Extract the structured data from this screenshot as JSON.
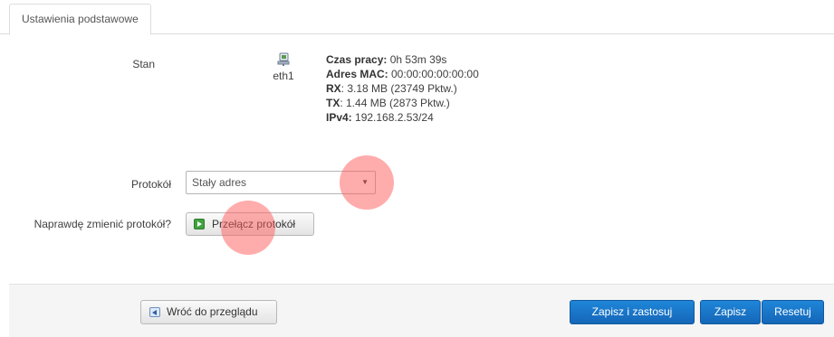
{
  "tabs": [
    {
      "label": "Ustawienia podstawowe",
      "active": true
    }
  ],
  "status": {
    "label": "Stan",
    "interface": {
      "name": "eth1",
      "icon": "ethernet-icon"
    },
    "uptime_label": "Czas pracy:",
    "uptime_value": " 0h 53m 39s",
    "mac_label": "Adres MAC:",
    "mac_value": " 00:00:00:00:00:00",
    "rx_label": "RX",
    "rx_value": ": 3.18 MB (23749 Pktw.)",
    "tx_label": "TX",
    "tx_value": ": 1.44 MB (2873 Pktw.)",
    "ipv4_label": "IPv4:",
    "ipv4_value": " 192.168.2.53/24"
  },
  "protocol": {
    "label": "Protokół",
    "selected": "Stały adres"
  },
  "change_protocol": {
    "label": "Naprawdę zmienić protokół?",
    "button": "Przełącz protokół"
  },
  "footer": {
    "back_button": "Wróć do przeglądu",
    "save_apply_button": "Zapisz i zastosuj",
    "save_button": "Zapisz",
    "reset_button": "Resetuj"
  },
  "colors": {
    "primary": "#1a75c9",
    "highlight": "#ff5a5a"
  }
}
